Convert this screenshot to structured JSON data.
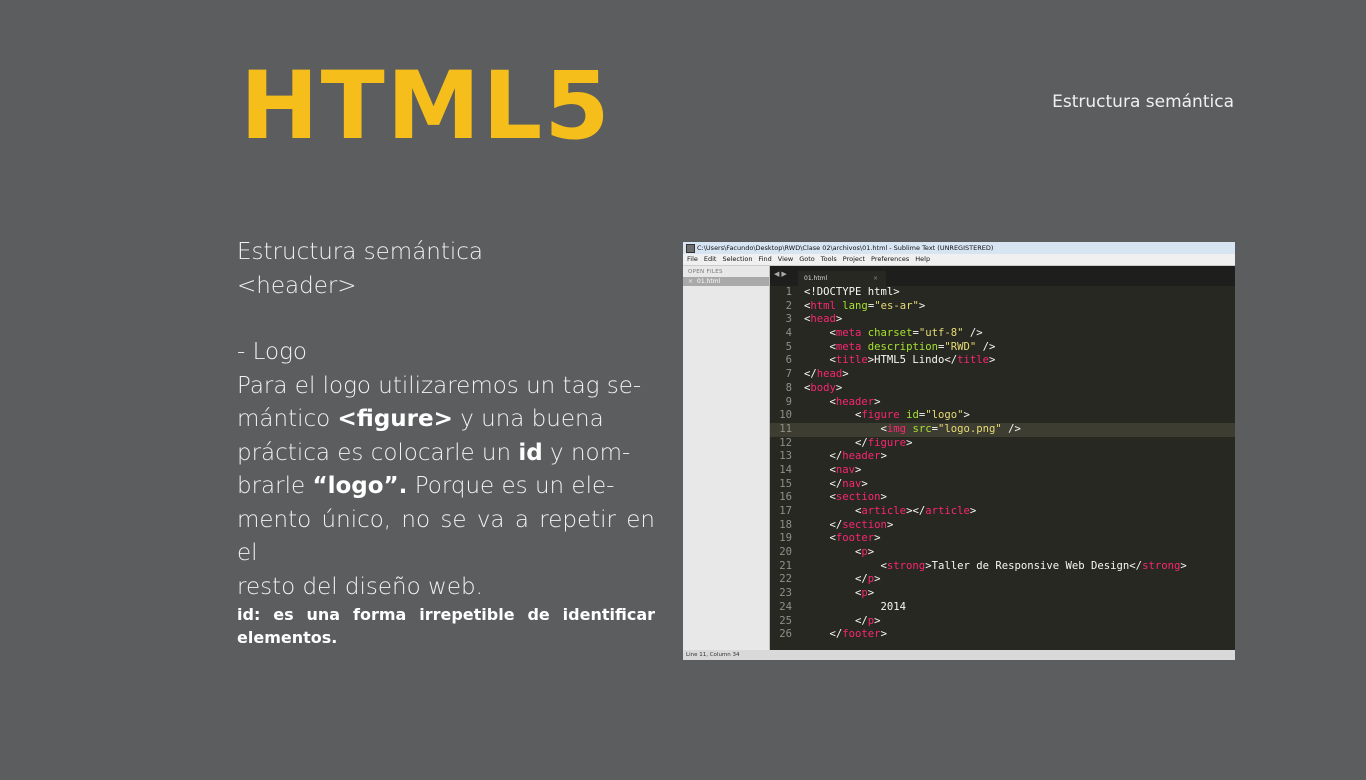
{
  "slide": {
    "title": "HTML5",
    "top_right": "Estructura semántica",
    "heading_1": "Estructura semántica",
    "heading_2": "<header>",
    "item": "- Logo",
    "para": {
      "l1": "Para el logo utilizaremos un tag se-",
      "l2a": "mántico ",
      "l2b": "<figure>",
      "l2c": " y una buena",
      "l3a": "práctica es colocarle un ",
      "l3b": "id",
      "l3c": " y nom-",
      "l4a": "brarle ",
      "l4b": "“logo”.",
      "l4c": " Porque es un ele-",
      "l5": "mento único, no se va a repetir en el",
      "l6": "resto del diseño web."
    },
    "note": "id: es una forma irrepetible de identificar elementos."
  },
  "sublime": {
    "title": "C:\\Users\\Facundo\\Desktop\\RWD\\Clase 02\\archivos\\01.html - Sublime Text (UNREGISTERED)",
    "menu": [
      "File",
      "Edit",
      "Selection",
      "Find",
      "View",
      "Goto",
      "Tools",
      "Project",
      "Preferences",
      "Help"
    ],
    "sidebar_header": "OPEN FILES",
    "sidebar_file": "01.html",
    "tab_label": "01.html",
    "status": "Line 11, Column 34",
    "current_line": 11,
    "code": [
      [
        [
          "t",
          "<!DOCTYPE html>"
        ]
      ],
      [
        [
          "t",
          "<"
        ],
        [
          "g",
          "html"
        ],
        [
          "t",
          " "
        ],
        [
          "a",
          "lang"
        ],
        [
          "t",
          "="
        ],
        [
          "s",
          "\"es-ar\""
        ],
        [
          "t",
          ">"
        ]
      ],
      [
        [
          "t",
          "<"
        ],
        [
          "g",
          "head"
        ],
        [
          "t",
          ">"
        ]
      ],
      [
        [
          "t",
          "    <"
        ],
        [
          "g",
          "meta"
        ],
        [
          "t",
          " "
        ],
        [
          "a",
          "charset"
        ],
        [
          "t",
          "="
        ],
        [
          "s",
          "\"utf-8\""
        ],
        [
          "t",
          " />"
        ]
      ],
      [
        [
          "t",
          "    <"
        ],
        [
          "g",
          "meta"
        ],
        [
          "t",
          " "
        ],
        [
          "a",
          "description"
        ],
        [
          "t",
          "="
        ],
        [
          "s",
          "\"RWD\""
        ],
        [
          "t",
          " />"
        ]
      ],
      [
        [
          "t",
          "    <"
        ],
        [
          "g",
          "title"
        ],
        [
          "t",
          ">HTML5 Lindo</"
        ],
        [
          "g",
          "title"
        ],
        [
          "t",
          ">"
        ]
      ],
      [
        [
          "t",
          "</"
        ],
        [
          "g",
          "head"
        ],
        [
          "t",
          ">"
        ]
      ],
      [
        [
          "t",
          "<"
        ],
        [
          "g",
          "body"
        ],
        [
          "t",
          ">"
        ]
      ],
      [
        [
          "t",
          "    <"
        ],
        [
          "g",
          "header"
        ],
        [
          "t",
          ">"
        ]
      ],
      [
        [
          "t",
          "        <"
        ],
        [
          "g",
          "figure"
        ],
        [
          "t",
          " "
        ],
        [
          "a",
          "id"
        ],
        [
          "t",
          "="
        ],
        [
          "s",
          "\"logo\""
        ],
        [
          "t",
          ">"
        ]
      ],
      [
        [
          "t",
          "            <"
        ],
        [
          "g",
          "img"
        ],
        [
          "t",
          " "
        ],
        [
          "a",
          "src"
        ],
        [
          "t",
          "="
        ],
        [
          "s",
          "\"logo.png\""
        ],
        [
          "t",
          " />"
        ]
      ],
      [
        [
          "t",
          "        </"
        ],
        [
          "g",
          "figure"
        ],
        [
          "t",
          ">"
        ]
      ],
      [
        [
          "t",
          "    </"
        ],
        [
          "g",
          "header"
        ],
        [
          "t",
          ">"
        ]
      ],
      [
        [
          "t",
          "    <"
        ],
        [
          "g",
          "nav"
        ],
        [
          "t",
          ">"
        ]
      ],
      [
        [
          "t",
          "    </"
        ],
        [
          "g",
          "nav"
        ],
        [
          "t",
          ">"
        ]
      ],
      [
        [
          "t",
          "    <"
        ],
        [
          "g",
          "section"
        ],
        [
          "t",
          ">"
        ]
      ],
      [
        [
          "t",
          "        <"
        ],
        [
          "g",
          "article"
        ],
        [
          "t",
          "></"
        ],
        [
          "g",
          "article"
        ],
        [
          "t",
          ">"
        ]
      ],
      [
        [
          "t",
          "    </"
        ],
        [
          "g",
          "section"
        ],
        [
          "t",
          ">"
        ]
      ],
      [
        [
          "t",
          "    <"
        ],
        [
          "g",
          "footer"
        ],
        [
          "t",
          ">"
        ]
      ],
      [
        [
          "t",
          "        <"
        ],
        [
          "g",
          "p"
        ],
        [
          "t",
          ">"
        ]
      ],
      [
        [
          "t",
          "            <"
        ],
        [
          "g",
          "strong"
        ],
        [
          "t",
          ">Taller de Responsive Web Design</"
        ],
        [
          "g",
          "strong"
        ],
        [
          "t",
          ">"
        ]
      ],
      [
        [
          "t",
          "        </"
        ],
        [
          "g",
          "p"
        ],
        [
          "t",
          ">"
        ]
      ],
      [
        [
          "t",
          "        <"
        ],
        [
          "g",
          "p"
        ],
        [
          "t",
          ">"
        ]
      ],
      [
        [
          "t",
          "            2014"
        ]
      ],
      [
        [
          "t",
          "        </"
        ],
        [
          "g",
          "p"
        ],
        [
          "t",
          ">"
        ]
      ],
      [
        [
          "t",
          "    </"
        ],
        [
          "g",
          "footer"
        ],
        [
          "t",
          ">"
        ]
      ]
    ]
  }
}
